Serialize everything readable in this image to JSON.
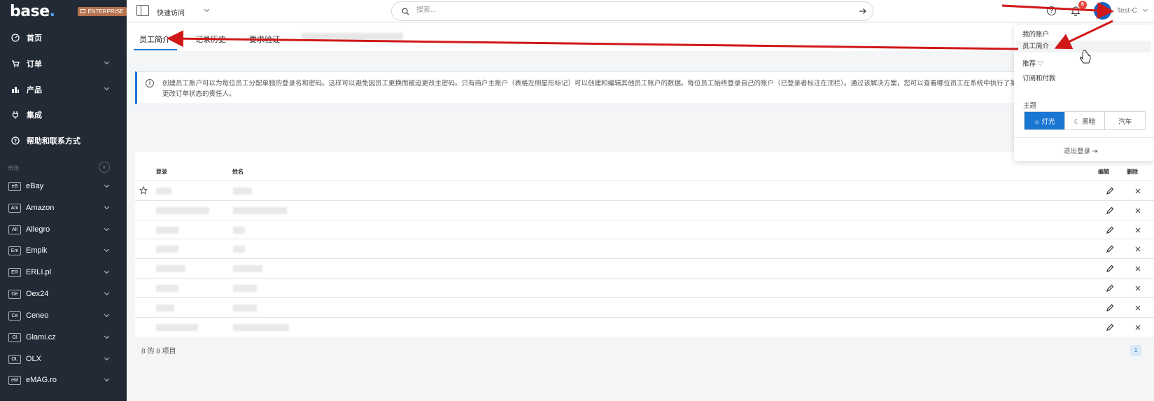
{
  "brand": {
    "logo": "base",
    "badge": "ENTERPRISE"
  },
  "sidebar": {
    "nav": [
      {
        "label": "首页",
        "icon": "dashboard-icon"
      },
      {
        "label": "订单",
        "icon": "cart-icon"
      },
      {
        "label": "产品",
        "icon": "products-icon"
      },
      {
        "label": "集成",
        "icon": "plug-icon"
      },
      {
        "label": "帮助和联系方式",
        "icon": "help-icon"
      }
    ],
    "market_label": "市场",
    "markets": [
      {
        "abbr": "eB",
        "label": "eBay"
      },
      {
        "abbr": "Am",
        "label": "Amazon"
      },
      {
        "abbr": "All",
        "label": "Allegro"
      },
      {
        "abbr": "Em",
        "label": "Empik"
      },
      {
        "abbr": "ER",
        "label": "ERLI.pl"
      },
      {
        "abbr": "Oe",
        "label": "Oex24"
      },
      {
        "abbr": "Ce",
        "label": "Ceneo"
      },
      {
        "abbr": "Gl",
        "label": "Glami.cz"
      },
      {
        "abbr": "OL",
        "label": "OLX"
      },
      {
        "abbr": "eM",
        "label": "eMAG.ro"
      }
    ]
  },
  "topbar": {
    "quick_access": "快速访问",
    "search_placeholder": "搜索...",
    "notification_count": "6",
    "user_name": "Test-C"
  },
  "tabs": [
    "员工简介",
    "记录历史",
    "要求验证"
  ],
  "info_text": "创建员工账户可以为每位员工分配单独的登录名和密码。这样可以避免因员工更换而被迫更改主密码。只有商户主账户（表格左侧星形标记）可以创建和编辑其他员工账户的数据。每位员工始终登录自己的账户（已登录者标注在顶栏）。通过该解决方案，您可以查看哪位员工在系统中执行了某项操作，例如发送了不良电子部件或意外更改订单状态的责任人。",
  "table": {
    "headers": {
      "login": "登录",
      "name": "姓名",
      "edit": "编辑",
      "delete": "删除"
    },
    "row_count": 8
  },
  "footer": {
    "count": "8 的 8 项目",
    "page": "1"
  },
  "dropdown": {
    "items": [
      "我的账户",
      "员工简介",
      "推荐 ♡",
      "订阅和付款"
    ],
    "theme_label": "主题",
    "themes": [
      "☼ 灯光",
      "☾ 黑暗",
      "汽车"
    ],
    "logout": "退出登录 ⇥"
  },
  "colors": {
    "accent": "#1976d2",
    "sidebar": "#222a36",
    "annotation": "#d01818"
  }
}
